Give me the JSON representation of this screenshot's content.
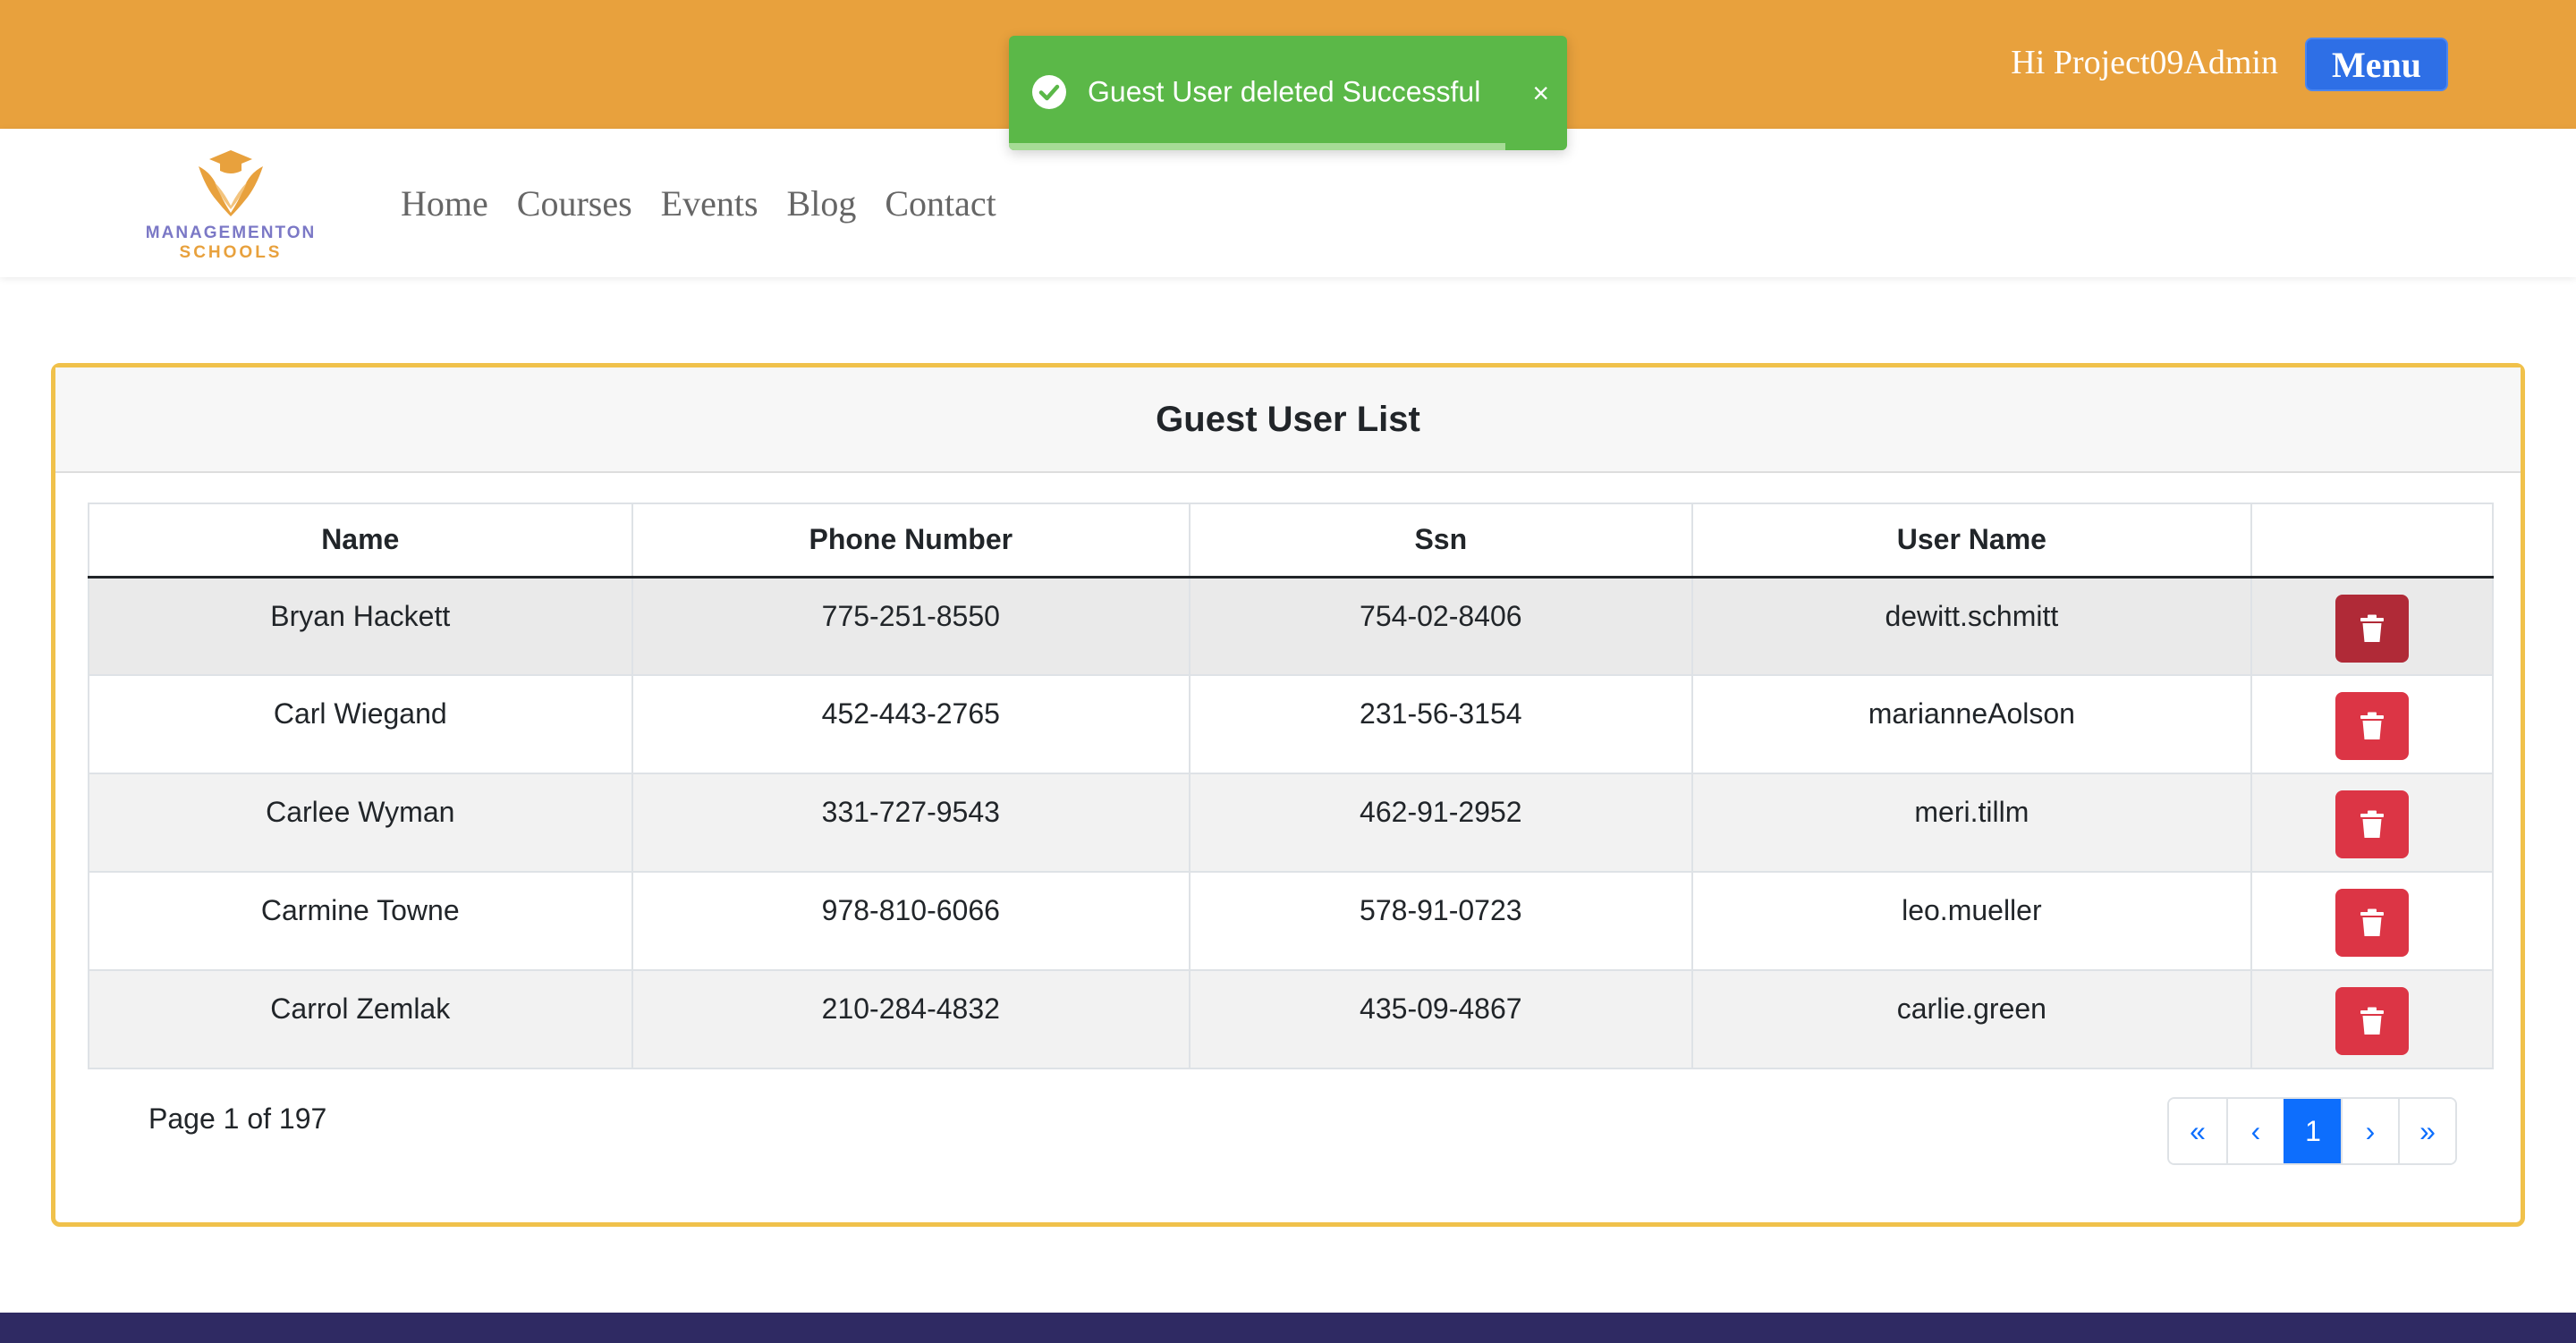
{
  "header": {
    "greeting": "Hi Project09Admin",
    "menu_label": "Menu",
    "accent_color": "#e8a13d"
  },
  "toast": {
    "message": "Guest User deleted Successful",
    "close_label": "×",
    "icon": "check-circle-icon",
    "progress": 0.89,
    "color": "#5bb848"
  },
  "logo": {
    "line1": "MANAGEMENTON",
    "line2": "SCHOOLS"
  },
  "nav": {
    "items": [
      "Home",
      "Courses",
      "Events",
      "Blog",
      "Contact"
    ]
  },
  "card": {
    "title": "Guest User List"
  },
  "table": {
    "columns": [
      "Name",
      "Phone Number",
      "Ssn",
      "User Name",
      ""
    ],
    "rows": [
      {
        "name": "Bryan Hackett",
        "phone": "775-251-8550",
        "ssn": "754-02-8406",
        "username": "dewitt.schmitt"
      },
      {
        "name": "Carl Wiegand",
        "phone": "452-443-2765",
        "ssn": "231-56-3154",
        "username": "marianneAolson"
      },
      {
        "name": "Carlee Wyman",
        "phone": "331-727-9543",
        "ssn": "462-91-2952",
        "username": "meri.tillm"
      },
      {
        "name": "Carmine Towne",
        "phone": "978-810-6066",
        "ssn": "578-91-0723",
        "username": "leo.mueller"
      },
      {
        "name": "Carrol Zemlak",
        "phone": "210-284-4832",
        "ssn": "435-09-4867",
        "username": "carlie.green"
      }
    ],
    "delete_icon": "trash-icon",
    "delete_color": "#dc3545"
  },
  "pagination": {
    "page_info": "Page 1 of 197",
    "first": "«",
    "prev": "‹",
    "current": "1",
    "next": "›",
    "last": "»"
  }
}
